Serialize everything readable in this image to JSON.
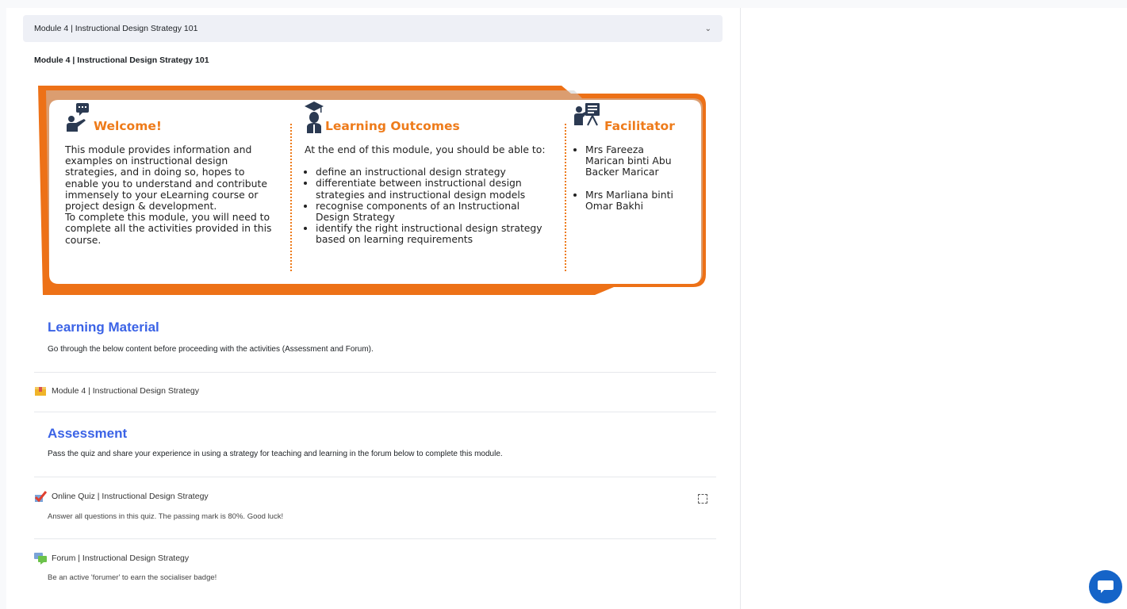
{
  "section": {
    "header_label": "Module 4 | Instructional Design Strategy 101",
    "title": "Module 4 | Instructional Design Strategy 101"
  },
  "banner": {
    "welcome": {
      "heading": "Welcome!",
      "text_lines": [
        "This module provides information and",
        "examples on instructional design",
        "strategies, and in doing so, hopes to",
        "enable you to understand and contribute",
        "immensely to your eLearning course or",
        "project design & development.",
        "To complete this module, you will need to",
        "complete all the activities provided in this",
        "course."
      ]
    },
    "outcomes": {
      "heading": "Learning Outcomes",
      "intro": "At the end of this module, you should be able to:",
      "items": [
        [
          "define an instructional design strategy"
        ],
        [
          "differentiate between instructional design",
          "strategies and instructional design models"
        ],
        [
          "recognise components of an Instructional",
          "Design Strategy"
        ],
        [
          "identify the right instructional design strategy",
          "based on learning requirements"
        ]
      ]
    },
    "facilitator": {
      "heading": "Facilitator",
      "names": [
        [
          "Mrs Fareeza",
          "Marican binti Abu",
          "Backer Maricar"
        ],
        [
          "Mrs Marliana binti",
          "Omar Bakhi"
        ]
      ]
    }
  },
  "learning_material": {
    "heading": "Learning Material",
    "text": "Go through the below content before proceeding with the activities (Assessment and Forum).",
    "activity_label": "Module 4 | Instructional Design Strategy"
  },
  "assessment": {
    "heading": "Assessment",
    "text": "Pass the quiz and share your experience in using a strategy for teaching and learning in the forum below to complete this module.",
    "quiz": {
      "label": "Online Quiz | Instructional Design Strategy",
      "description": "Answer all questions in this quiz. The passing mark is 80%. Good luck!"
    },
    "forum": {
      "label": "Forum | Instructional Design Strategy",
      "description": "Be an active 'forumer' to earn the socialiser badge!"
    }
  },
  "icons": {
    "collapse": "chevron-down-icon",
    "package": "package-icon",
    "quiz": "quiz-check-icon",
    "forum": "forum-icon",
    "chat": "chat-icon"
  },
  "colors": {
    "accent_orange": "#ee7b1a",
    "heading_blue": "#3b63e6",
    "chat_blue": "#1564c8"
  }
}
